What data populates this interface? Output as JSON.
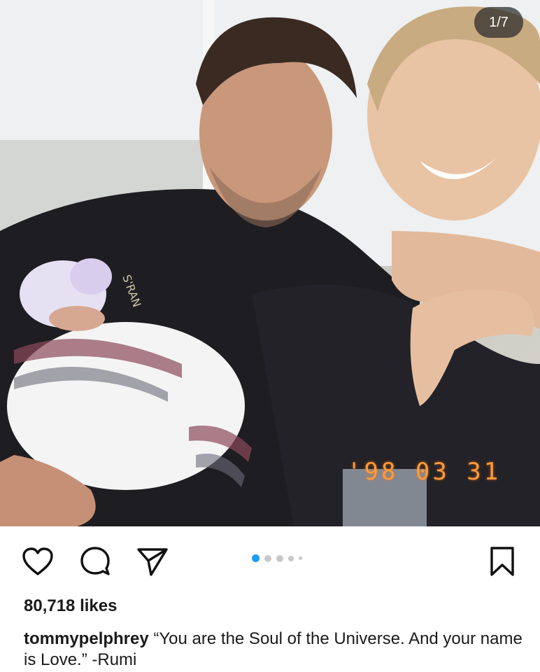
{
  "post": {
    "image_counter": "1/7",
    "date_stamp": "'98 03 31",
    "likes": "80,718 likes",
    "username": "tommypelphrey",
    "caption": " “You are the Soul of the Universe.  And your name is Love.” -Rumi",
    "carousel": {
      "total_dots": 5,
      "active_index": 0
    }
  },
  "colors": {
    "accent_dot": "#1d9bf0",
    "inactive_dot": "#c8c8c8",
    "date_stamp": "#ff9a3c"
  },
  "icons": [
    "heart-icon",
    "comment-icon",
    "share-icon",
    "bookmark-icon"
  ]
}
